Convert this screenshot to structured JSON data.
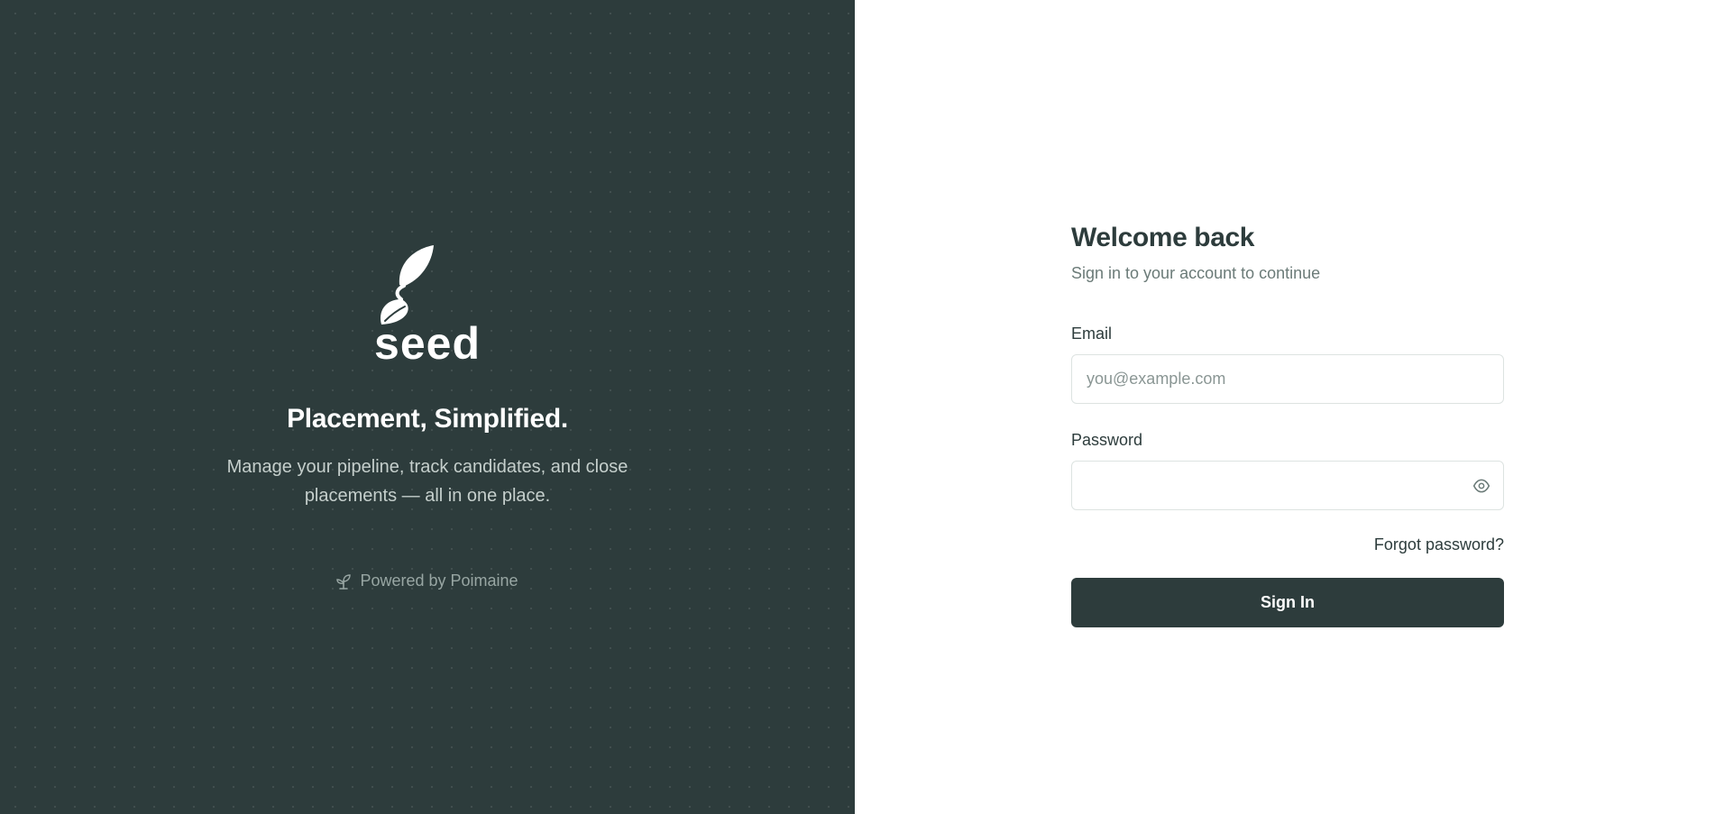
{
  "brand": {
    "logo_icon": "seed-sprout-icon",
    "logo_text": "seed",
    "tagline": "Placement, Simplified.",
    "description": "Manage your pipeline, track candidates, and close placements — all in one place.",
    "powered_icon": "sprout-icon",
    "powered_by": "Powered by Poimaine",
    "panel_color": "#2d3c3c"
  },
  "form": {
    "title": "Welcome back",
    "subtitle": "Sign in to your account to continue",
    "email_label": "Email",
    "email_placeholder": "you@example.com",
    "email_value": "",
    "password_label": "Password",
    "password_value": "",
    "password_toggle_icon": "eye-icon",
    "forgot_link": "Forgot password?",
    "submit_label": "Sign In",
    "accent_color": "#2d3c3c"
  }
}
